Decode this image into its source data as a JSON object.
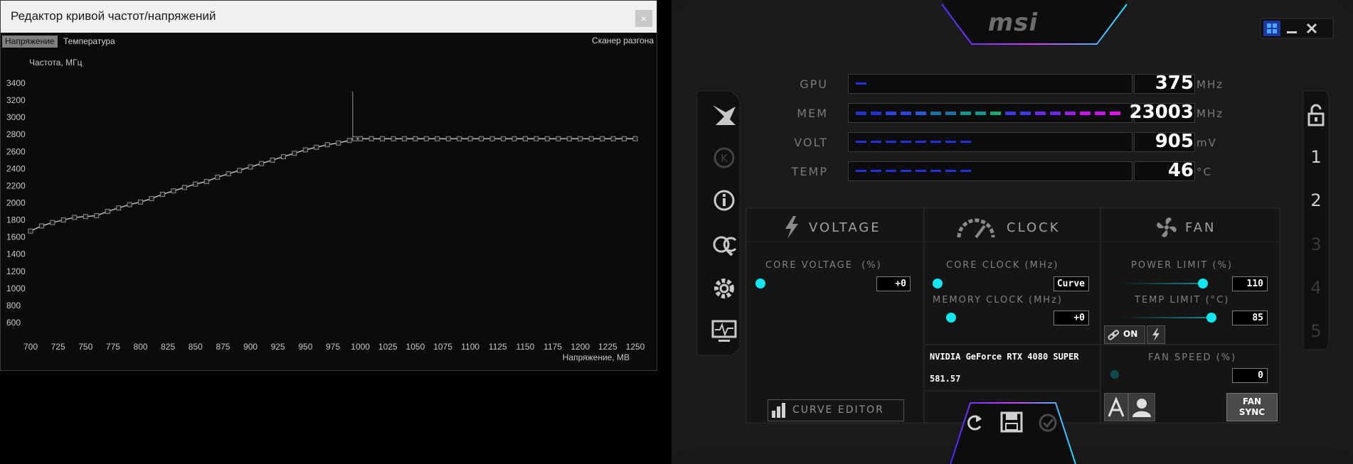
{
  "curve_editor": {
    "title": "Редактор кривой частот/напряжений",
    "close_glyph": "×",
    "tabs": [
      "Напряжение",
      "Температура"
    ],
    "active_tab": "Напряжение",
    "scanner_label": "Сканер разгона",
    "chart_data": {
      "type": "line",
      "ylabel": "Частота, МГц",
      "xlabel": "Напряжение, МВ",
      "xlim": [
        700,
        1250
      ],
      "ylim": [
        500,
        3500
      ],
      "x_ticks": [
        "700",
        "725",
        "750",
        "775",
        "800",
        "825",
        "850",
        "875",
        "900",
        "925",
        "950",
        "975",
        "1000",
        "1025",
        "1050",
        "1075",
        "1100",
        "1125",
        "1150",
        "1175",
        "1200",
        "1225",
        "1250"
      ],
      "y_ticks": [
        "3400",
        "3200",
        "3000",
        "2800",
        "2600",
        "2400",
        "2200",
        "2000",
        "1800",
        "1600",
        "1400",
        "1200",
        "1000",
        "800",
        "600"
      ],
      "grid": false,
      "series": [
        {
          "x": [
            700,
            710,
            720,
            730,
            740,
            750,
            760,
            770,
            780,
            790,
            800,
            810,
            820,
            830,
            840,
            850,
            860,
            870,
            880,
            890,
            900,
            910,
            920,
            930,
            940,
            950,
            960,
            970,
            980,
            990,
            995,
            1000,
            1010,
            1020,
            1030,
            1040,
            1050,
            1060,
            1070,
            1080,
            1090,
            1100,
            1110,
            1120,
            1130,
            1140,
            1150,
            1160,
            1170,
            1180,
            1190,
            1200,
            1210,
            1220,
            1230,
            1240,
            1250
          ],
          "y": [
            1670,
            1730,
            1770,
            1800,
            1830,
            1840,
            1850,
            1900,
            1940,
            1980,
            2010,
            2050,
            2100,
            2140,
            2180,
            2220,
            2250,
            2300,
            2340,
            2380,
            2420,
            2460,
            2500,
            2540,
            2580,
            2620,
            2650,
            2680,
            2700,
            2730,
            2750,
            2750,
            2750,
            2750,
            2750,
            2750,
            2750,
            2750,
            2750,
            2750,
            2750,
            2750,
            2750,
            2750,
            2750,
            2750,
            2750,
            2750,
            2750,
            2750,
            2750,
            2750,
            2750,
            2750,
            2750,
            2750,
            2750
          ]
        }
      ],
      "annotations": [
        {
          "x": 993,
          "y_from": 2740,
          "y_to": 3300,
          "note": "spike line"
        }
      ]
    }
  },
  "msi": {
    "logo": "msi",
    "window_controls": [
      "windows-icon",
      "minimize-icon",
      "close-icon"
    ],
    "monitors": [
      {
        "label": "GPU",
        "value": "375",
        "unit": "MHz",
        "fill": 0.06
      },
      {
        "label": "MEM",
        "value": "23003",
        "unit": "MHz",
        "fill": 1.0
      },
      {
        "label": "VOLT",
        "value": "905",
        "unit": "mV",
        "fill": 0.44
      },
      {
        "label": "TEMP",
        "value": "46",
        "unit": "°C",
        "fill": 0.46
      }
    ],
    "left_icons": [
      "msi-dragon-icon",
      "kombustor-icon",
      "info-icon",
      "oc-scanner-icon",
      "settings-icon",
      "monitor-icon"
    ],
    "profiles": {
      "lock": "lock-icon",
      "items": [
        "1",
        "2",
        "3",
        "4",
        "5"
      ]
    },
    "sections": {
      "voltage": {
        "title": "VOLTAGE",
        "core_voltage_label": "CORE VOLTAGE",
        "core_voltage_unit": "(%)",
        "core_voltage_value": "+0",
        "curve_editor_label": "CURVE EDITOR"
      },
      "clock": {
        "title": "CLOCK",
        "core_clock_label": "CORE CLOCK",
        "core_clock_unit": "(MHz)",
        "core_clock_value": "Curve",
        "memory_clock_label": "MEMORY CLOCK",
        "memory_clock_unit": "(MHz)",
        "memory_clock_value": "+0",
        "gpu_name": "NVIDIA GeForce RTX 4080 SUPER",
        "driver": "581.57"
      },
      "fan": {
        "title": "FAN",
        "power_limit_label": "POWER LIMIT",
        "power_limit_unit": "(%)",
        "power_limit_value": "110",
        "temp_limit_label": "TEMP LIMIT",
        "temp_limit_unit": "(°C)",
        "temp_limit_value": "85",
        "link_on": "ON",
        "fan_speed_label": "FAN SPEED",
        "fan_speed_unit": "(%)",
        "fan_speed_value": "0",
        "fan_sync": [
          "FAN",
          "SYNC"
        ]
      }
    },
    "bottom_buttons": [
      "reset-icon",
      "save-icon",
      "apply-icon"
    ]
  }
}
